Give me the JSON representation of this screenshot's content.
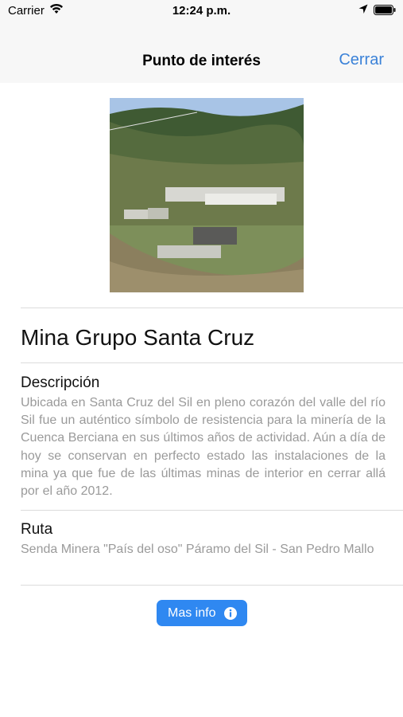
{
  "status": {
    "carrier": "Carrier",
    "time": "12:24 p.m."
  },
  "nav": {
    "title": "Punto de interés",
    "close_label": "Cerrar"
  },
  "poi": {
    "name": "Mina Grupo Santa Cruz",
    "description_title": "Descripción",
    "description": "Ubicada en Santa Cruz del Sil en pleno corazón del valle del río Sil fue un auténtico símbolo de resistencia para la minería de la Cuenca Berciana en sus últimos años de actividad. Aún a día de hoy se conservan en perfecto estado las instalaciones de la mina ya que fue de las últimas minas de interior en cerrar allá por el año 2012.",
    "route_title": "Ruta",
    "route": "Senda Minera \"País del oso\" Páramo del Sil - San Pedro Mallo"
  },
  "more_info": {
    "label": "Mas info",
    "icon": "info-icon"
  },
  "colors": {
    "accent": "#2f88f1",
    "nav_link": "#3b82d8",
    "secondary_text": "#9a9a9a"
  }
}
